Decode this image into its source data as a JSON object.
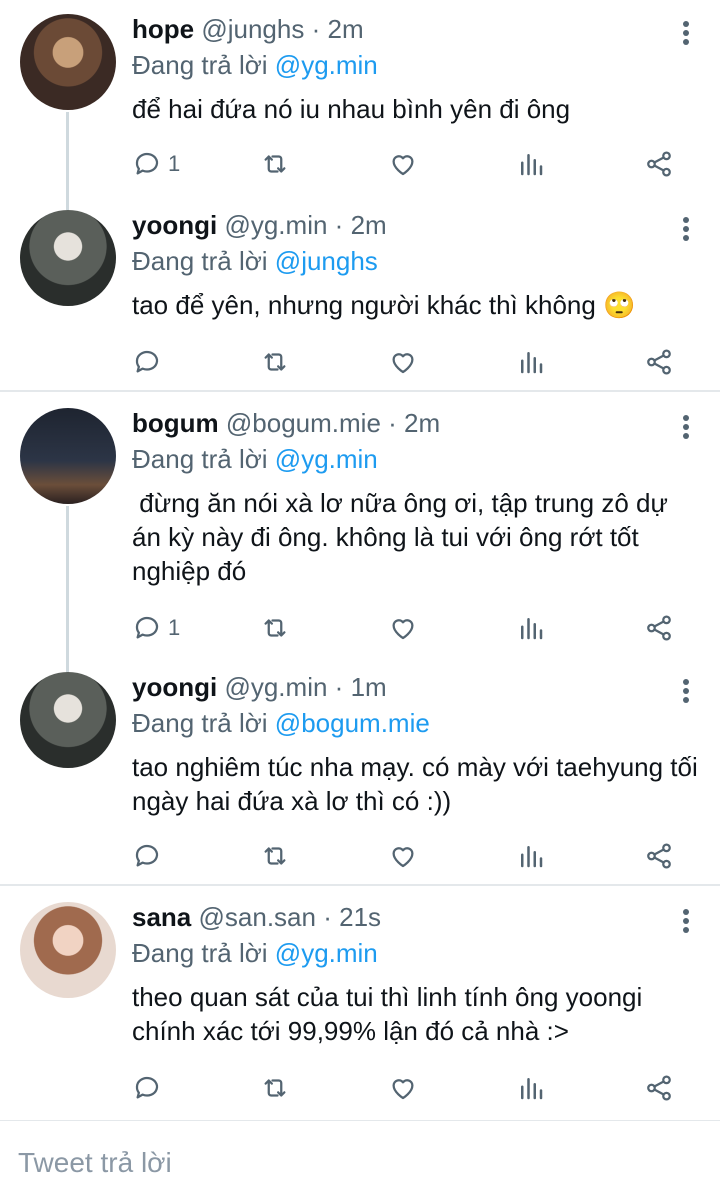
{
  "tweets": [
    {
      "name": "hope",
      "handle": "@junghs",
      "time": "2m",
      "reply_prefix": "Đang trả lời",
      "reply_to": "@yg.min",
      "text": "để hai đứa nó iu nhau bình yên đi ông",
      "reply_count": "1"
    },
    {
      "name": "yoongi",
      "handle": "@yg.min",
      "time": "2m",
      "reply_prefix": "Đang trả lời",
      "reply_to": "@junghs",
      "text": "tao để yên, nhưng người khác thì không 🙄",
      "reply_count": ""
    },
    {
      "name": "bogum",
      "handle": "@bogum.mie",
      "time": "2m",
      "reply_prefix": "Đang trả lời",
      "reply_to": "@yg.min",
      "text": " đừng ăn nói xà lơ nữa ông ơi, tập trung zô dự án kỳ này đi ông. không là tui với ông rớt tốt nghiệp đó",
      "reply_count": "1"
    },
    {
      "name": "yoongi",
      "handle": "@yg.min",
      "time": "1m",
      "reply_prefix": "Đang trả lời",
      "reply_to": "@bogum.mie",
      "text": "tao nghiêm túc nha mạy. có mày với taehyung tối ngày hai đứa xà lơ thì có :))",
      "reply_count": ""
    },
    {
      "name": "sana",
      "handle": "@san.san",
      "time": "21s",
      "reply_prefix": "Đang trả lời",
      "reply_to": "@yg.min",
      "text": "theo quan sát của tui thì linh tính ông yoongi chính xác tới 99,99% lận đó cả nhà :>",
      "reply_count": ""
    }
  ],
  "separator": "·",
  "composer": {
    "placeholder": "Tweet trả lời"
  },
  "icons": [
    "reply-icon",
    "retweet-icon",
    "like-icon",
    "analytics-icon",
    "share-icon",
    "more-icon"
  ],
  "colors": {
    "mention": "#1d9bf0",
    "secondary": "#536471",
    "divider": "#e4e8eb"
  }
}
